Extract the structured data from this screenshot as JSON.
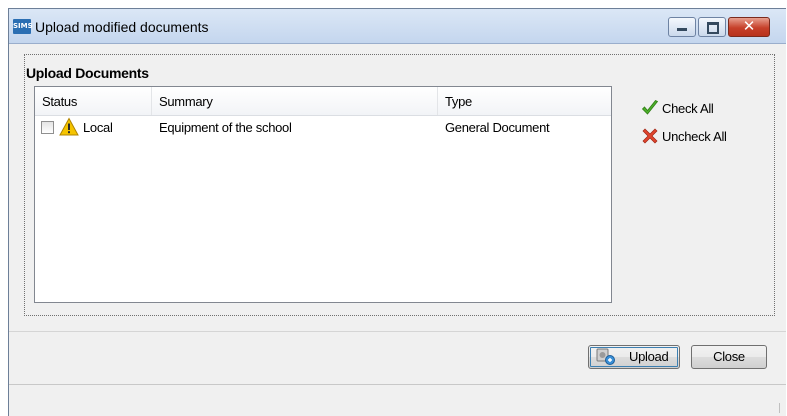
{
  "window": {
    "app_badge": "SIMS",
    "title": "Upload modified documents",
    "controls": {
      "minimize": "minimize-icon",
      "maximize": "maximize-icon",
      "close": "close-icon"
    }
  },
  "group": {
    "label": "Upload Documents"
  },
  "table": {
    "columns": [
      "Status",
      "Summary",
      "Type"
    ],
    "rows": [
      {
        "checked": false,
        "status_icon": "warning-icon",
        "status": "Local",
        "summary": "Equipment of the school",
        "type": "General Document"
      }
    ]
  },
  "actions": {
    "check_all": {
      "label": "Check All",
      "icon": "green-check-icon",
      "color": "#4caf2a"
    },
    "uncheck_all": {
      "label": "Uncheck All",
      "icon": "red-x-icon",
      "color": "#d9402b"
    }
  },
  "buttons": {
    "upload": {
      "label": "Upload",
      "icon": "upload-icon"
    },
    "close": {
      "label": "Close"
    }
  }
}
